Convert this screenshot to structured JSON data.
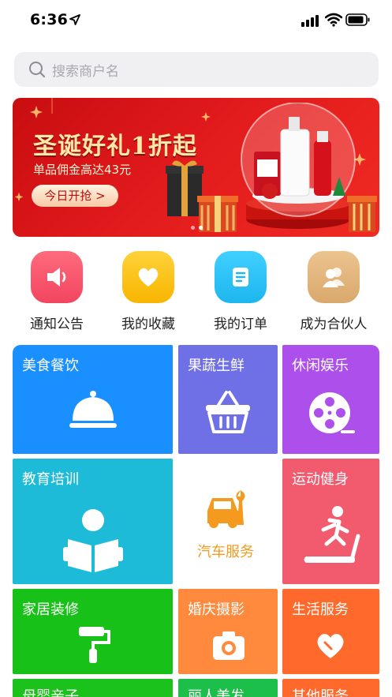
{
  "status_bar": {
    "time": "6:36"
  },
  "search": {
    "placeholder": "搜索商户名"
  },
  "banner": {
    "title": "圣诞好礼1折起",
    "subtitle": "单品佣金高达43元",
    "button_label": "今日开抢 >",
    "slides_total": 2,
    "active_slide": 2
  },
  "shortcuts": [
    {
      "label": "通知公告",
      "icon": "speaker-icon",
      "color": "#f2455f"
    },
    {
      "label": "我的收藏",
      "icon": "heart-icon",
      "color": "#f7b500"
    },
    {
      "label": "我的订单",
      "icon": "list-icon",
      "color": "#1eb6ef"
    },
    {
      "label": "成为合伙人",
      "icon": "partner-icon",
      "color": "#d9a86c"
    }
  ],
  "categories": [
    {
      "label": "美食餐饮",
      "icon": "food-cover-icon",
      "color": "#1a8fff"
    },
    {
      "label": "果蔬生鲜",
      "icon": "basket-icon",
      "color": "#6f6fe6"
    },
    {
      "label": "休闲娱乐",
      "icon": "film-reel-icon",
      "color": "#ad4fea"
    },
    {
      "label": "教育培训",
      "icon": "reading-icon",
      "color": "#1ebbd8"
    },
    {
      "label": "汽车服务",
      "icon": "car-wrench-icon",
      "color": "#f39a1f"
    },
    {
      "label": "运动健身",
      "icon": "treadmill-icon",
      "color": "#f25b6e"
    },
    {
      "label": "家居装修",
      "icon": "paint-roller-icon",
      "color": "#17c117"
    },
    {
      "label": "婚庆摄影",
      "icon": "camera-icon",
      "color": "#ff8a3d"
    },
    {
      "label": "生活服务",
      "icon": "heart-hand-icon",
      "color": "#ff6a2c"
    },
    {
      "label": "母婴亲子",
      "icon": "",
      "color": "#1bc21b"
    },
    {
      "label": "丽人美发",
      "icon": "",
      "color": "#1bbf4a"
    },
    {
      "label": "其他服务",
      "icon": "",
      "color": "#ff6a2c"
    }
  ]
}
